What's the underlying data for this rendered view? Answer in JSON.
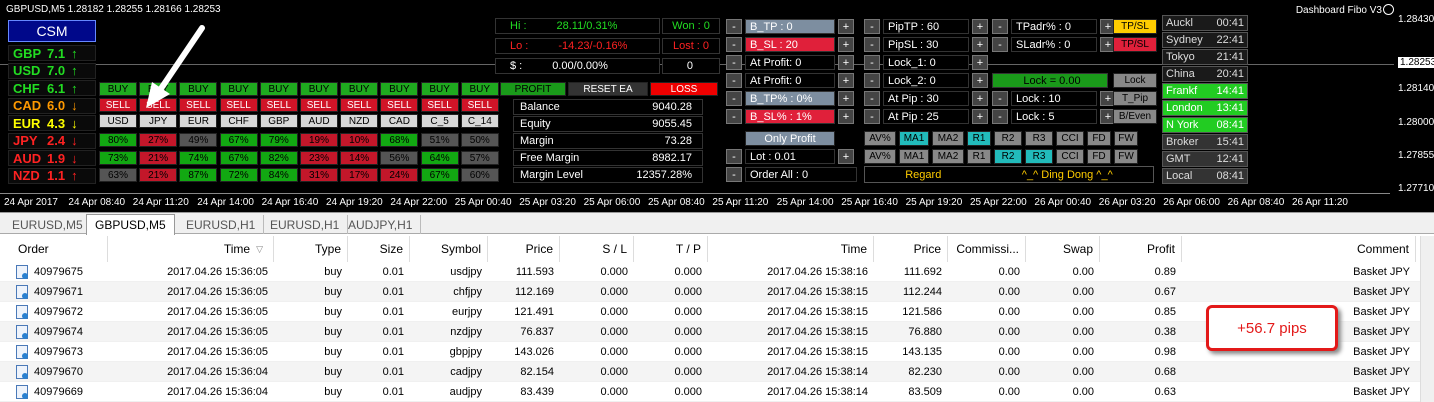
{
  "chart": {
    "title": "GBPUSD,M5  1.28182 1.28255 1.28166 1.28253",
    "dashboard_title": "Dashboard Fibo V3",
    "y_ticks": [
      "1.28430",
      "1.28253",
      "1.28140",
      "1.28000",
      "1.27855",
      "1.27710"
    ],
    "x_ticks": [
      "24 Apr 2017",
      "24 Apr 08:40",
      "24 Apr 11:20",
      "24 Apr 14:00",
      "24 Apr 16:40",
      "24 Apr 19:20",
      "24 Apr 22:00",
      "25 Apr 00:40",
      "25 Apr 03:20",
      "25 Apr 06:00",
      "25 Apr 08:40",
      "25 Apr 11:20",
      "25 Apr 14:00",
      "25 Apr 16:40",
      "25 Apr 19:20",
      "25 Apr 22:00",
      "26 Apr 00:40",
      "26 Apr 03:20",
      "26 Apr 06:00",
      "26 Apr 08:40",
      "26 Apr 11:20"
    ]
  },
  "csm": {
    "title": "CSM",
    "rows": [
      {
        "cur": "GBP",
        "val": "7.1",
        "dir": "↑",
        "color": "#22dd22"
      },
      {
        "cur": "USD",
        "val": "7.0",
        "dir": "↑",
        "color": "#22dd22"
      },
      {
        "cur": "CHF",
        "val": "6.1",
        "dir": "↑",
        "color": "#22dd22"
      },
      {
        "cur": "CAD",
        "val": "6.0",
        "dir": "↓",
        "color": "#ff9900"
      },
      {
        "cur": "EUR",
        "val": "4.3",
        "dir": "↓",
        "color": "#ffff00"
      },
      {
        "cur": "JPY",
        "val": "2.4",
        "dir": "↓",
        "color": "#ff2222"
      },
      {
        "cur": "AUD",
        "val": "1.9",
        "dir": "↓",
        "color": "#ff2222"
      },
      {
        "cur": "NZD",
        "val": "1.1",
        "dir": "↑",
        "color": "#ff2222"
      }
    ]
  },
  "matrix": {
    "buy": "BUY",
    "sell": "SELL",
    "currencies": [
      "USD",
      "JPY",
      "EUR",
      "CHF",
      "GBP",
      "AUD",
      "NZD",
      "CAD",
      "C_5",
      "C_14"
    ],
    "row1": [
      "80%",
      "27%",
      "49%",
      "67%",
      "79%",
      "19%",
      "10%",
      "68%",
      "51%",
      "50%"
    ],
    "row1_type": [
      "g",
      "r",
      "x",
      "g",
      "g",
      "r",
      "r",
      "g",
      "x",
      "x"
    ],
    "row2": [
      "73%",
      "21%",
      "74%",
      "67%",
      "82%",
      "23%",
      "14%",
      "56%",
      "64%",
      "57%"
    ],
    "row2_type": [
      "g",
      "r",
      "g",
      "g",
      "g",
      "r",
      "r",
      "x",
      "g",
      "x"
    ],
    "row3": [
      "63%",
      "21%",
      "87%",
      "72%",
      "84%",
      "31%",
      "17%",
      "24%",
      "67%",
      "60%"
    ],
    "row3_type": [
      "x",
      "r",
      "g",
      "g",
      "g",
      "r",
      "r",
      "r",
      "g",
      "x"
    ]
  },
  "stats": {
    "hi_label": "Hi :",
    "hi_val": "28.11/0.31%",
    "lo_label": "Lo :",
    "lo_val": "-14.23/-0.16%",
    "dollar_label": "$ :",
    "dollar_val": "0.00/0.00%",
    "won": "Won : 0",
    "lost": "Lost : 0",
    "zero": "0",
    "profit_btn": "PROFIT",
    "reset_btn": "RESET EA",
    "loss_btn": "LOSS",
    "balance_label": "Balance",
    "balance_val": "9040.28",
    "equity_label": "Equity",
    "equity_val": "9055.45",
    "margin_label": "Margin",
    "margin_val": "73.28",
    "free_margin_label": "Free Margin",
    "free_margin_val": "8982.17",
    "margin_level_label": "Margin Level",
    "margin_level_val": "12357.28%"
  },
  "controls": {
    "b_tp": "B_TP : 0",
    "b_sl": "B_SL : 20",
    "at_profit1": "At Profit: 0",
    "at_profit2": "At Profit: 0",
    "b_tp_pct": "B_TP% : 0%",
    "b_sl_pct": "B_SL% : 1%",
    "only_profit": "Only Profit",
    "lot": "Lot : 0.01",
    "order_all": "Order All : 0",
    "piptp": "PipTP  : 60",
    "pipsl": "PipSL  : 30",
    "lock1": "Lock_1: 0",
    "lock2": "Lock_2: 0",
    "at_pip1": "At Pip : 30",
    "at_pip2": "At Pip : 25",
    "tpadr": "TPadr% : 0",
    "sladr": "SLadr% : 0",
    "tpsl_btn": "TP/SL",
    "tpsl_btn2": "TP/SL",
    "lock_eq": "Lock =  0.00",
    "lock_btn": "Lock",
    "lock10": "Lock : 10",
    "tpip_btn": "T_Pip",
    "lock5": "Lock : 5",
    "beven_btn": "B/Even",
    "ind_row1": [
      "AV%",
      "MA1",
      "MA2",
      "R1",
      "R2",
      "R3",
      "CCI",
      "FD",
      "FW"
    ],
    "ind_row2": [
      "AV%",
      "MA1",
      "MA2",
      "R1",
      "R2",
      "R3",
      "CCI",
      "FD",
      "FW"
    ],
    "regard": "Regard",
    "ding": "^_^ Ding Dong ^_^",
    "minus": "-",
    "plus": "+"
  },
  "sessions": [
    {
      "name": "Auckl",
      "time": "00:41",
      "style": "dark"
    },
    {
      "name": "Sydney",
      "time": "22:41",
      "style": "dark"
    },
    {
      "name": "Tokyo",
      "time": "21:41",
      "style": "dark"
    },
    {
      "name": "China",
      "time": "20:41",
      "style": "dark"
    },
    {
      "name": "Frankf",
      "time": "14:41",
      "style": "green"
    },
    {
      "name": "London",
      "time": "13:41",
      "style": "green"
    },
    {
      "name": "N York",
      "time": "08:41",
      "style": "green"
    },
    {
      "name": "Broker",
      "time": "15:41",
      "style": "gray"
    },
    {
      "name": "GMT",
      "time": "12:41",
      "style": "gray"
    },
    {
      "name": "Local",
      "time": "08:41",
      "style": "gray"
    }
  ],
  "tabs": [
    "EURUSD,M5",
    "GBPUSD,M5",
    "EURUSD,H1",
    "EURUSD,H1",
    "AUDJPY,H1"
  ],
  "grid": {
    "headers": [
      "Order",
      "Time",
      "Type",
      "Size",
      "Symbol",
      "Price",
      "S / L",
      "T / P",
      "Time",
      "Price",
      "Commissi...",
      "Swap",
      "Profit",
      "Comment"
    ],
    "rows": [
      [
        "40979675",
        "2017.04.26 15:36:05",
        "buy",
        "0.01",
        "usdjpy",
        "111.593",
        "0.000",
        "0.000",
        "2017.04.26 15:38:16",
        "111.692",
        "0.00",
        "0.00",
        "0.89",
        "Basket JPY"
      ],
      [
        "40979671",
        "2017.04.26 15:36:05",
        "buy",
        "0.01",
        "chfjpy",
        "112.169",
        "0.000",
        "0.000",
        "2017.04.26 15:38:15",
        "112.244",
        "0.00",
        "0.00",
        "0.67",
        "Basket JPY"
      ],
      [
        "40979672",
        "2017.04.26 15:36:05",
        "buy",
        "0.01",
        "eurjpy",
        "121.491",
        "0.000",
        "0.000",
        "2017.04.26 15:38:15",
        "121.586",
        "0.00",
        "0.00",
        "0.85",
        "Basket JPY"
      ],
      [
        "40979674",
        "2017.04.26 15:36:05",
        "buy",
        "0.01",
        "nzdjpy",
        "76.837",
        "0.000",
        "0.000",
        "2017.04.26 15:38:15",
        "76.880",
        "0.00",
        "0.00",
        "0.38",
        "Basket JPY"
      ],
      [
        "40979673",
        "2017.04.26 15:36:05",
        "buy",
        "0.01",
        "gbpjpy",
        "143.026",
        "0.000",
        "0.000",
        "2017.04.26 15:38:15",
        "143.135",
        "0.00",
        "0.00",
        "0.98",
        "Basket JPY"
      ],
      [
        "40979670",
        "2017.04.26 15:36:04",
        "buy",
        "0.01",
        "cadjpy",
        "82.154",
        "0.000",
        "0.000",
        "2017.04.26 15:38:14",
        "82.230",
        "0.00",
        "0.00",
        "0.68",
        "Basket JPY"
      ],
      [
        "40979669",
        "2017.04.26 15:36:04",
        "buy",
        "0.01",
        "audjpy",
        "83.439",
        "0.000",
        "0.000",
        "2017.04.26 15:38:14",
        "83.509",
        "0.00",
        "0.00",
        "0.63",
        "Basket JPY"
      ]
    ]
  },
  "callout": "+56.7 pips"
}
